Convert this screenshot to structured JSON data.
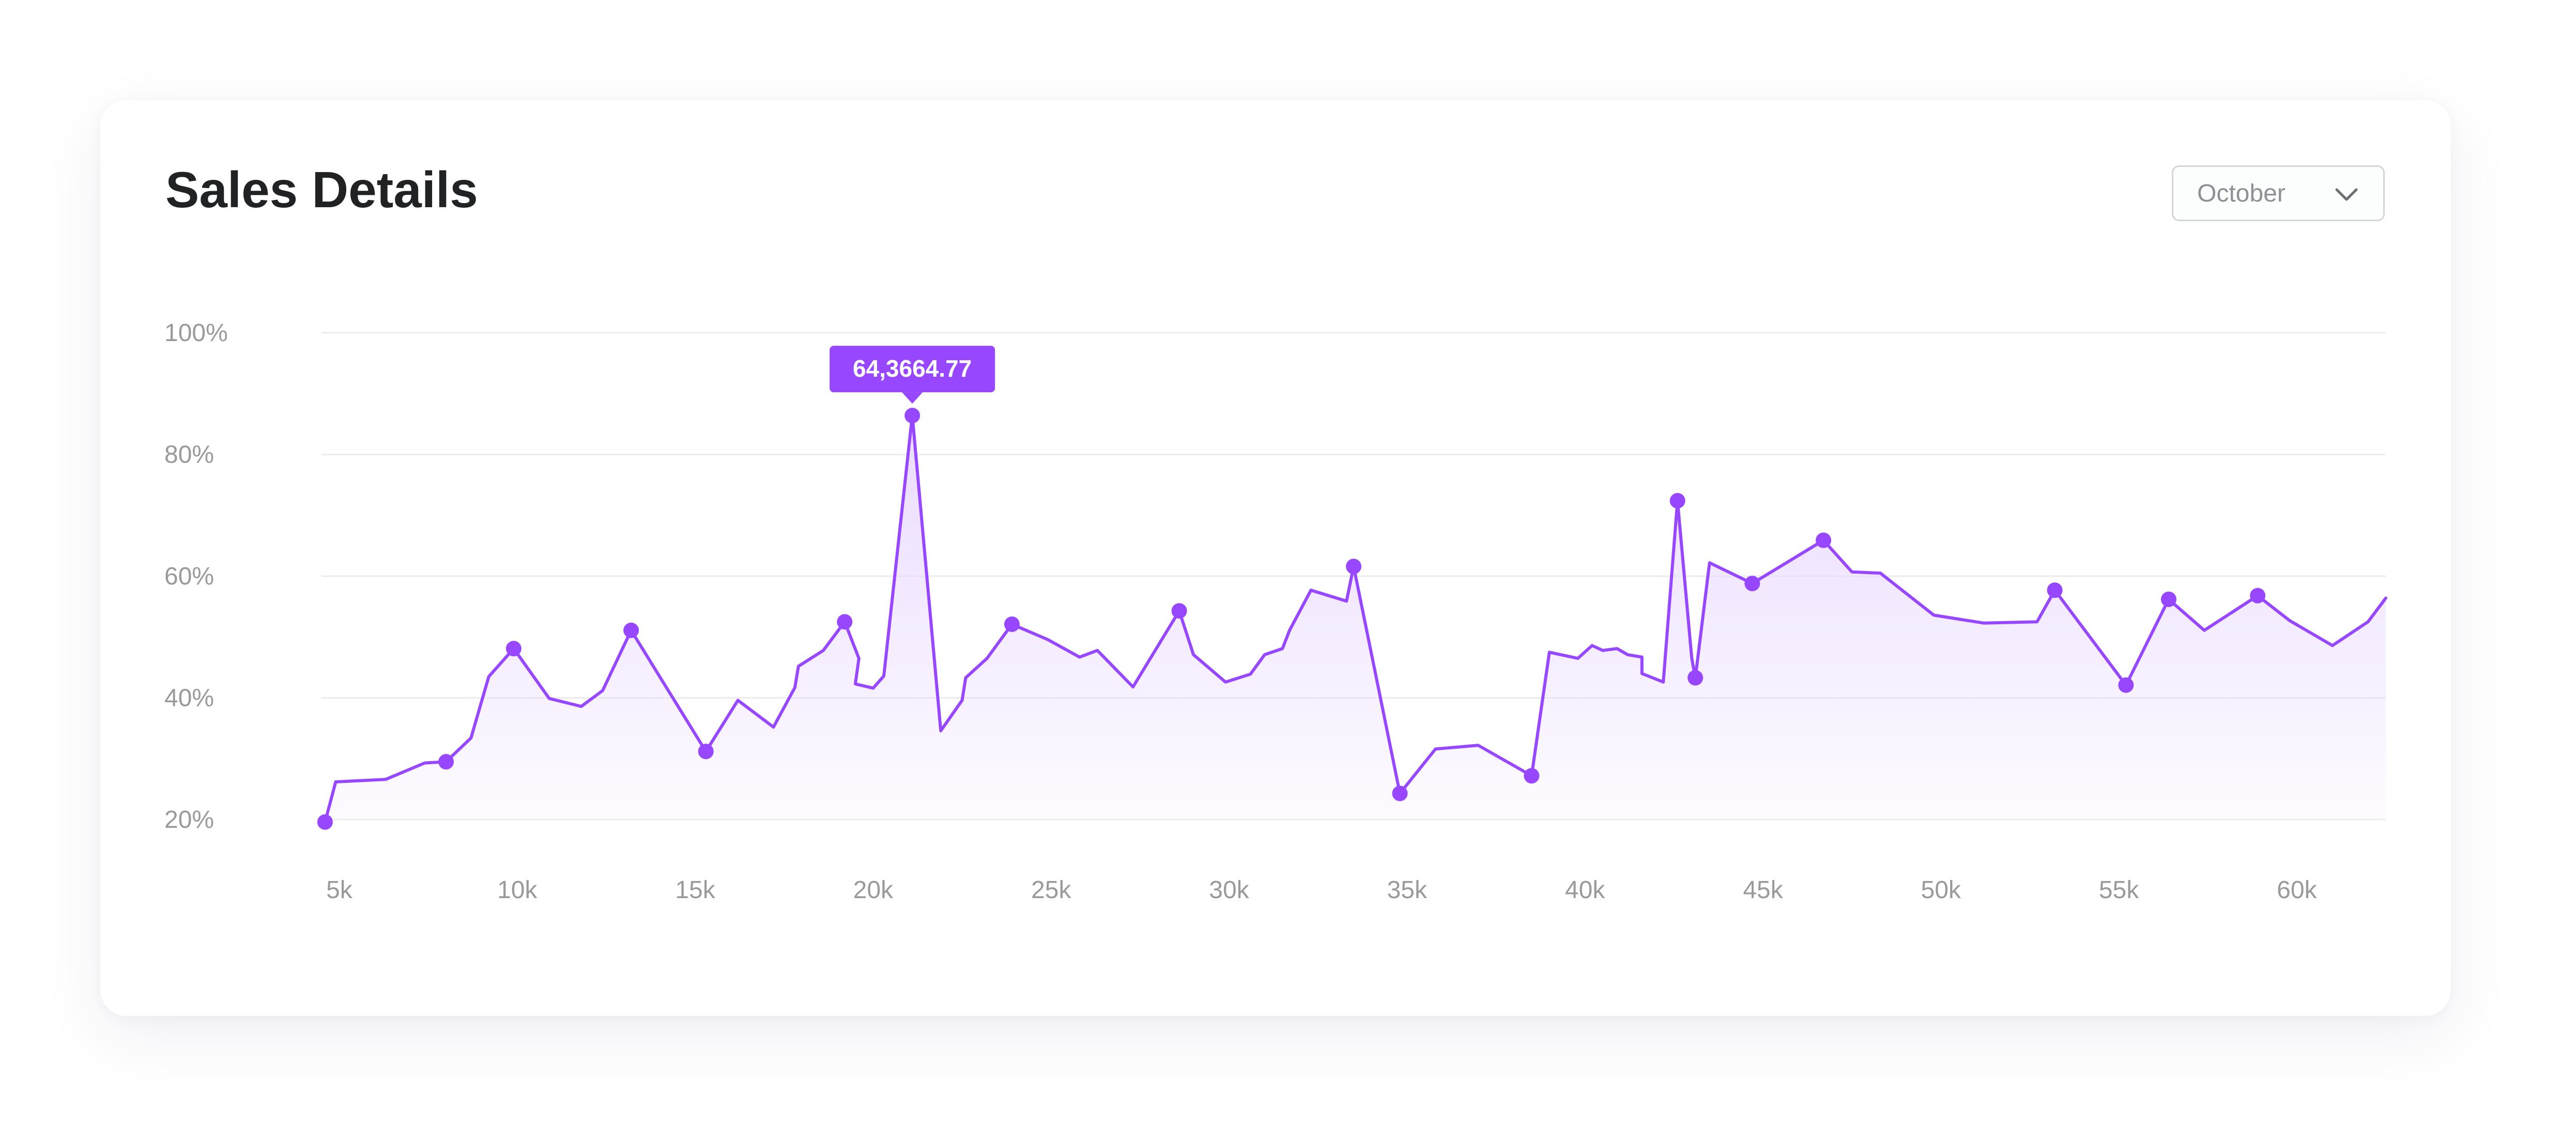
{
  "header": {
    "title": "Sales Details"
  },
  "month_select": {
    "value": "October"
  },
  "icons": {
    "dropdown": "chevron-down-icon"
  },
  "colors": {
    "accent": "#9747ff",
    "grid": "#ececec",
    "axis_text": "#9a9a9a",
    "title": "#202224",
    "fill_top": "#e9d9ff"
  },
  "chart_data": {
    "type": "area",
    "title": "",
    "xlabel": "",
    "ylabel": "",
    "grid": true,
    "x_ticks": [
      "5k",
      "10k",
      "15k",
      "20k",
      "25k",
      "30k",
      "35k",
      "40k",
      "45k",
      "50k",
      "55k",
      "60k"
    ],
    "x_tick_values": [
      5000,
      10000,
      15000,
      20000,
      25000,
      30000,
      35000,
      40000,
      45000,
      50000,
      55000,
      60000
    ],
    "y_ticks": [
      "20%",
      "40%",
      "60%",
      "80%",
      "100%"
    ],
    "y_tick_values": [
      20,
      40,
      60,
      80,
      100
    ],
    "xlim": [
      4500,
      62500
    ],
    "ylim": [
      20,
      100
    ],
    "tooltip": {
      "label": "64,3664.77",
      "point_index": 28
    },
    "series": [
      {
        "points": [
          [
            4600,
            19.6,
            true
          ],
          [
            4900,
            26.2,
            false
          ],
          [
            6300,
            26.6,
            false
          ],
          [
            7400,
            29.3,
            false
          ],
          [
            8000,
            29.5,
            true
          ],
          [
            8700,
            33.4,
            false
          ],
          [
            9200,
            43.5,
            false
          ],
          [
            9900,
            48.1,
            true
          ],
          [
            10900,
            39.9,
            false
          ],
          [
            11800,
            38.6,
            false
          ],
          [
            12400,
            41.2,
            false
          ],
          [
            13200,
            51.1,
            true
          ],
          [
            15300,
            31.2,
            true
          ],
          [
            16200,
            39.6,
            false
          ],
          [
            17200,
            35.2,
            false
          ],
          [
            17800,
            41.7,
            false
          ],
          [
            17900,
            45.2,
            false
          ],
          [
            18600,
            47.8,
            false
          ],
          [
            19200,
            52.5,
            true
          ],
          [
            19600,
            46.5,
            false
          ],
          [
            19500,
            42.3,
            false
          ],
          [
            20000,
            41.6,
            false
          ],
          [
            20300,
            43.6,
            false
          ],
          [
            21100,
            86.4,
            true
          ],
          [
            21900,
            34.6,
            false
          ],
          [
            22500,
            39.6,
            false
          ],
          [
            22600,
            43.3,
            false
          ],
          [
            23200,
            46.5,
            false
          ],
          [
            23900,
            52.1,
            true
          ],
          [
            24900,
            49.6,
            false
          ],
          [
            25800,
            46.7,
            false
          ],
          [
            26300,
            47.8,
            false
          ],
          [
            27300,
            41.8,
            false
          ],
          [
            28600,
            54.3,
            true
          ],
          [
            29000,
            47.1,
            false
          ],
          [
            29900,
            42.6,
            false
          ],
          [
            30600,
            43.9,
            false
          ],
          [
            31000,
            47.1,
            false
          ],
          [
            31500,
            48.1,
            false
          ],
          [
            31700,
            51.1,
            false
          ],
          [
            32300,
            57.7,
            false
          ],
          [
            33300,
            55.9,
            false
          ],
          [
            33500,
            61.6,
            true
          ],
          [
            34800,
            24.3,
            true
          ],
          [
            35800,
            31.6,
            false
          ],
          [
            37000,
            32.2,
            false
          ],
          [
            38500,
            27.2,
            true
          ],
          [
            39000,
            47.5,
            false
          ],
          [
            39800,
            46.5,
            false
          ],
          [
            40200,
            48.6,
            false
          ],
          [
            40500,
            47.8,
            false
          ],
          [
            40900,
            48.1,
            false
          ],
          [
            41200,
            47.1,
            false
          ],
          [
            41600,
            46.7,
            false
          ],
          [
            41600,
            44.0,
            false
          ],
          [
            42200,
            42.6,
            false
          ],
          [
            42600,
            72.4,
            true
          ],
          [
            43000,
            46.5,
            false
          ],
          [
            43100,
            43.3,
            true
          ],
          [
            43500,
            62.2,
            false
          ],
          [
            44700,
            58.8,
            true
          ],
          [
            46700,
            65.9,
            true
          ],
          [
            47500,
            60.7,
            false
          ],
          [
            48300,
            60.5,
            false
          ],
          [
            49800,
            53.6,
            false
          ],
          [
            51200,
            52.3,
            false
          ],
          [
            52700,
            52.5,
            false
          ],
          [
            53200,
            57.7,
            true
          ],
          [
            55200,
            42.1,
            true
          ],
          [
            56400,
            56.2,
            true
          ],
          [
            57400,
            51.1,
            false
          ],
          [
            58900,
            56.8,
            true
          ],
          [
            59800,
            52.7,
            false
          ],
          [
            61000,
            48.6,
            false
          ],
          [
            62000,
            52.5,
            false
          ],
          [
            62500,
            56.4,
            false
          ]
        ]
      }
    ]
  }
}
